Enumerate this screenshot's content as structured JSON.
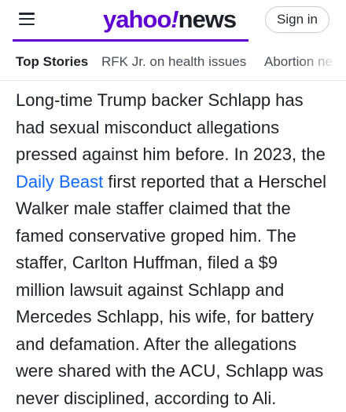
{
  "header": {
    "logo_yahoo": "yahoo",
    "logo_bang": "!",
    "logo_news": "news",
    "signin_label": "Sign in",
    "menu_icon": "hamburger-menu-icon",
    "brand_color": "#6001d2"
  },
  "tabs": [
    {
      "label": "Top Stories",
      "active": true
    },
    {
      "label": "RFK Jr. on health issues",
      "active": false
    },
    {
      "label": "Abortion ne",
      "active": false
    }
  ],
  "article": {
    "line1": "Long-time Trump backer Schlapp has",
    "line2": "had sexual misconduct allegations",
    "line3": "pressed against him before. In 2023, the",
    "line4_link": "Daily Beast",
    "line4_rest": " first reported that a Herschel",
    "line5": "Walker male staffer claimed that the",
    "line6": "famed conservative groped him. The",
    "line7": "staffer, Carlton Huffman, filed a $9",
    "line8": "million lawsuit against Schlapp and",
    "line9": "Mercedes Schlapp, his wife, for battery",
    "line10": "and defamation. After the allegations",
    "line11": "were shared with the ACU, Schlapp was",
    "line12": "never disciplined, according to Ali.",
    "link_color": "#0f69ff"
  }
}
